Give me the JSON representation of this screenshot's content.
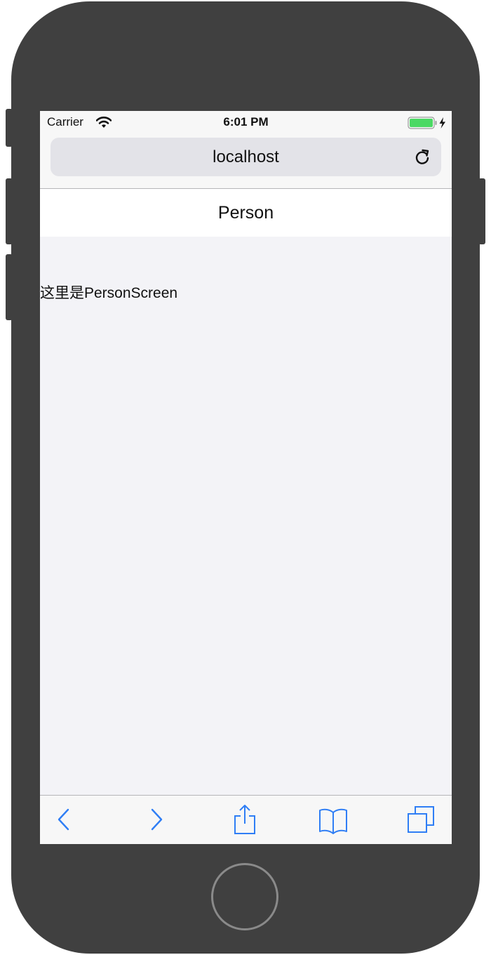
{
  "status_bar": {
    "carrier": "Carrier",
    "time": "6:01 PM",
    "icons": [
      "wifi-icon",
      "battery-charging-icon"
    ]
  },
  "browser": {
    "url": "localhost",
    "reload_icon": "reload-icon",
    "toolbar": [
      "back-icon",
      "forward-icon",
      "share-icon",
      "bookmarks-icon",
      "tabs-icon"
    ]
  },
  "app": {
    "header_title": "Person",
    "content_text": "这里是PersonScreen"
  },
  "colors": {
    "device": "#404040",
    "accent": "#2f7ef5",
    "battery": "#4cd964",
    "screen_bg": "#f3f3f7"
  }
}
